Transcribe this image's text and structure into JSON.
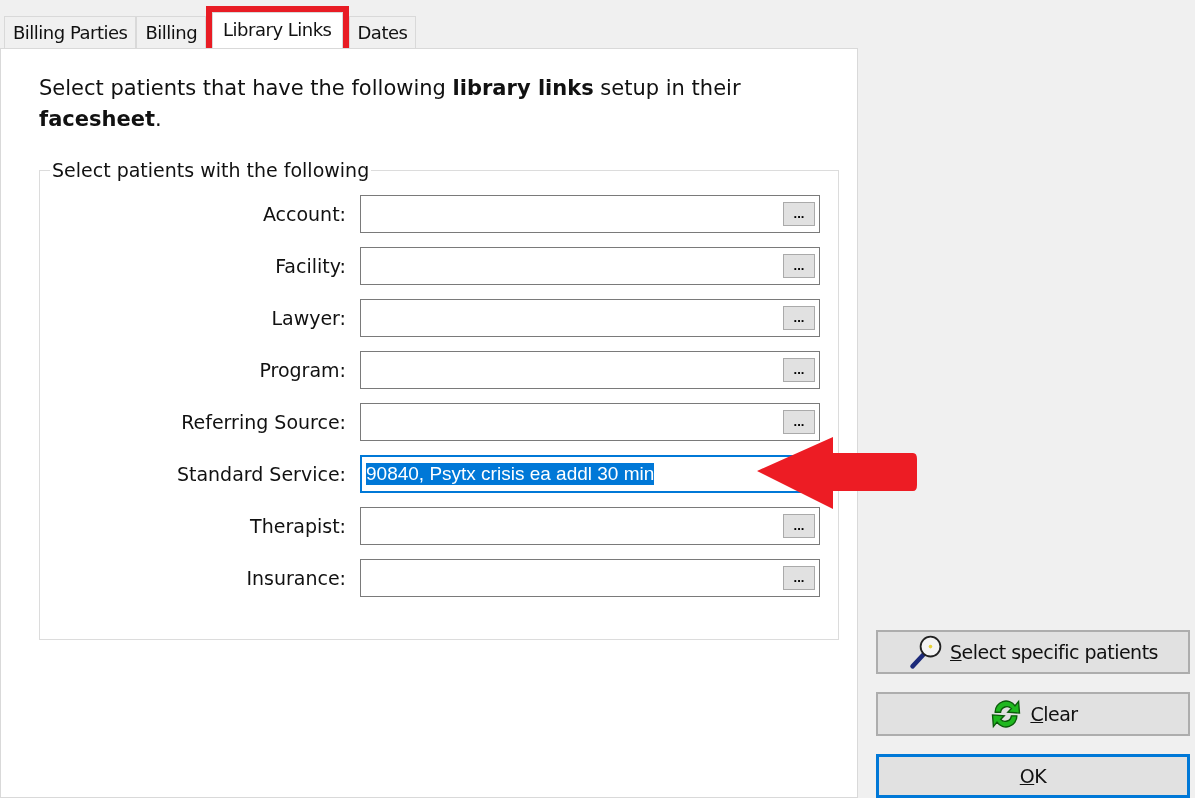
{
  "tabs": [
    {
      "label": "Billing Parties",
      "selected": false,
      "highlighted": false
    },
    {
      "label": "Billing",
      "selected": false,
      "highlighted": false
    },
    {
      "label": "Library Links",
      "selected": true,
      "highlighted": true
    },
    {
      "label": "Dates",
      "selected": false,
      "highlighted": false
    }
  ],
  "instructions": "Select patients that have the following **library links** setup in their **facesheet**.",
  "group": {
    "title": "Select patients with the following",
    "fields": [
      {
        "label": "Account:",
        "focused": false,
        "browse": "..."
      },
      {
        "label": "Facility:",
        "focused": false,
        "browse": "..."
      },
      {
        "label": "Lawyer:",
        "focused": false,
        "browse": "..."
      },
      {
        "label": "Program:",
        "focused": false,
        "browse": "..."
      },
      {
        "label": "Referring Source:",
        "focused": false,
        "browse": "..."
      },
      {
        "label": "Standard Service:",
        "value": "90840, Psytx crisis ea addl 30 min",
        "focused": true,
        "annotated": true
      },
      {
        "label": "Therapist:",
        "focused": false,
        "browse": "..."
      },
      {
        "label": "Insurance:",
        "focused": false,
        "browse": "..."
      }
    ]
  },
  "buttons": [
    {
      "label": "Select specific patients",
      "kind": "search",
      "default": false
    },
    {
      "label": "Clear",
      "kind": "refresh",
      "default": false
    },
    {
      "label": "OK",
      "kind": "plain",
      "default": true
    }
  ]
}
